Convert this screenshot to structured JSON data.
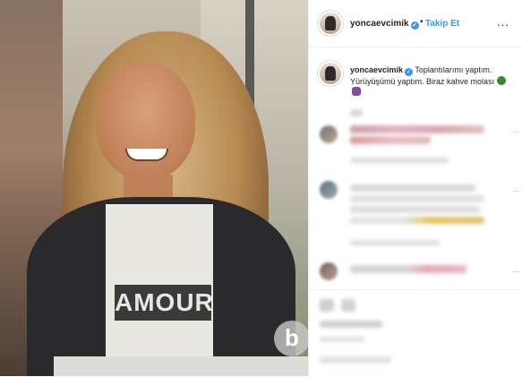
{
  "post": {
    "photo_shirt_print": "AMOUR",
    "watermark_letter": "b"
  },
  "header": {
    "username": "yoncaevcimik",
    "separator": "•",
    "follow_label": "Takip Et",
    "more_label": "..."
  },
  "caption": {
    "username": "yoncaevcimik",
    "text": "Toplantılarımı yaptım. Yürüyüşümü yaptım. Biraz kahve molası"
  },
  "colors": {
    "accent": "#3897f0",
    "text": "#262626"
  },
  "comments": [
    {
      "more": "..."
    },
    {
      "more": "..."
    },
    {
      "more": "..."
    }
  ]
}
